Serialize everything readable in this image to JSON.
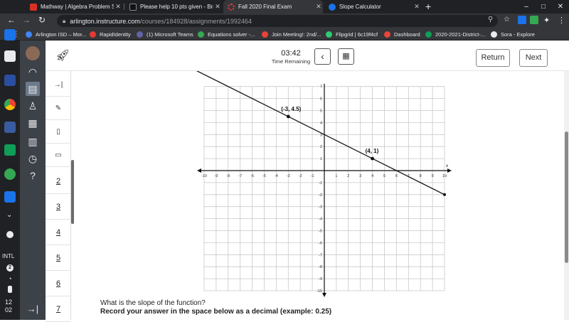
{
  "browser": {
    "tabs": [
      {
        "title": "Mathway | Algebra Problem Solv",
        "color": "#d93025",
        "active": false
      },
      {
        "title": "Please help 10 pts given - Brainl",
        "color": "#111111",
        "active": false
      },
      {
        "title": "Fall 2020 Final Exam",
        "color": "#e8453c",
        "active": true
      },
      {
        "title": "Slope Calculator",
        "color": "#1a73e8",
        "active": false
      }
    ],
    "url_host": "arlington.instructure.com",
    "url_path": "/courses/184928/assignments/1992464",
    "bookmarks": [
      {
        "label": "Arlington ISD – Mor...",
        "color": "#4285f4"
      },
      {
        "label": "RapidIdentity",
        "color": "#e53935"
      },
      {
        "label": "(1) Microsoft Teams",
        "color": "#6264a7"
      },
      {
        "label": "Equations solver -...",
        "color": "#34a853"
      },
      {
        "label": "Join Meeting!: 2nd/...",
        "color": "#ea4335"
      },
      {
        "label": "Flipgrid | 6c19f4cf",
        "color": "#2ecc71"
      },
      {
        "label": "Dashboard",
        "color": "#e8453c"
      },
      {
        "label": "2020-2021-District-...",
        "color": "#0f9d58"
      },
      {
        "label": "Sora - Explore",
        "color": "#e8eaed"
      }
    ]
  },
  "system": {
    "input_method": "INTL",
    "notification_badge": "2",
    "time_hour": "12",
    "time_minute": "02"
  },
  "exam": {
    "timer": "03:42",
    "timer_label": "Time Remaining",
    "return_label": "Return",
    "next_label": "Next",
    "question_numbers": [
      "2",
      "3",
      "4",
      "5",
      "6",
      "7"
    ],
    "question_text": "What is the slope of the function?",
    "instruction_text": "Record your answer in the space below as a decimal (example: 0.25)"
  },
  "chart_data": {
    "type": "line",
    "xlabel": "x",
    "ylabel": "",
    "xlim": [
      -10,
      10
    ],
    "ylim": [
      -10,
      7
    ],
    "x_ticks": [
      -10,
      -9,
      -8,
      -7,
      -6,
      -5,
      -4,
      -3,
      -2,
      -1,
      1,
      2,
      3,
      4,
      5,
      6,
      7,
      8,
      9,
      10
    ],
    "y_ticks": [
      7,
      6,
      5,
      4,
      3,
      2,
      1,
      -1,
      -2,
      -3,
      -4,
      -5,
      -6,
      -7,
      -8,
      -9,
      -10
    ],
    "grid": true,
    "line": {
      "slope": -0.5,
      "intercept": 3,
      "x_range": [
        -10,
        10
      ]
    },
    "points": [
      {
        "x": -3,
        "y": 4.5,
        "label": "(-3, 4.5)"
      },
      {
        "x": 4,
        "y": 1,
        "label": "(4, 1)"
      }
    ]
  }
}
